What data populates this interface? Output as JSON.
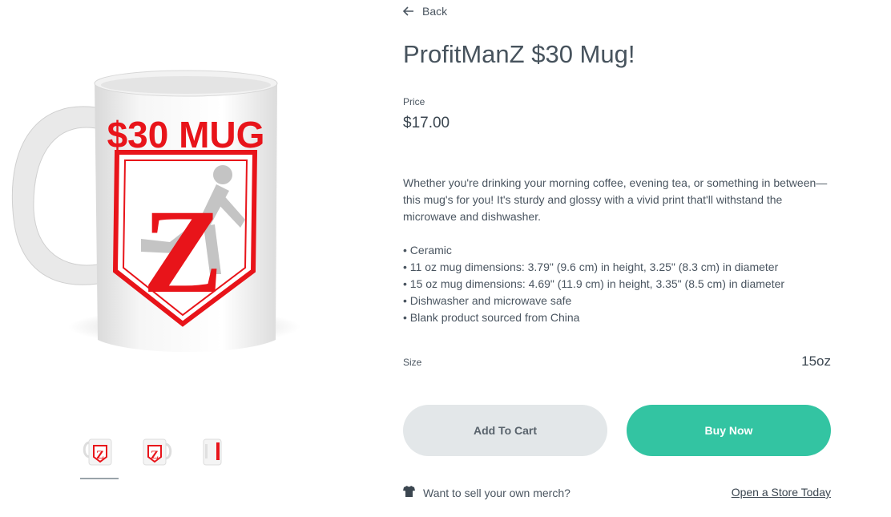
{
  "gallery": {
    "main_image": "mug-photo",
    "mug_print_text": "$30 MUG",
    "mug_logo_letter": "Z",
    "thumbnails": [
      "mug-front-thumb",
      "mug-left-thumb",
      "mug-side-thumb"
    ],
    "active_thumbnail": 0
  },
  "back": {
    "label": "Back",
    "icon": "arrow-left-icon"
  },
  "product": {
    "title": "ProfitManZ $30 Mug!",
    "price_label": "Price",
    "price": "$17.00",
    "description": "Whether you're drinking your morning coffee, evening tea, or something in between—this mug's for you! It's sturdy and glossy with a vivid print that'll withstand the microwave and dishwasher.",
    "bullets": [
      "• Ceramic",
      "• 11 oz mug dimensions: 3.79\" (9.6 cm) in height, 3.25\" (8.3 cm) in diameter",
      "• 15 oz mug dimensions: 4.69\" (11.9 cm) in height, 3.35\" (8.5 cm) in diameter",
      "• Dishwasher and microwave safe",
      "• Blank product sourced from China"
    ],
    "size_label": "Size",
    "size_value": "15oz"
  },
  "actions": {
    "add_to_cart": "Add To Cart",
    "buy_now": "Buy Now"
  },
  "footer": {
    "merch_icon": "tshirt-icon",
    "merch_text": "Want to sell your own merch?",
    "store_link": "Open a Store Today"
  },
  "colors": {
    "accent": "#33c4a2",
    "secondary_button": "#e3e7e9",
    "print_red": "#e8141a",
    "text": "#3b4650"
  }
}
